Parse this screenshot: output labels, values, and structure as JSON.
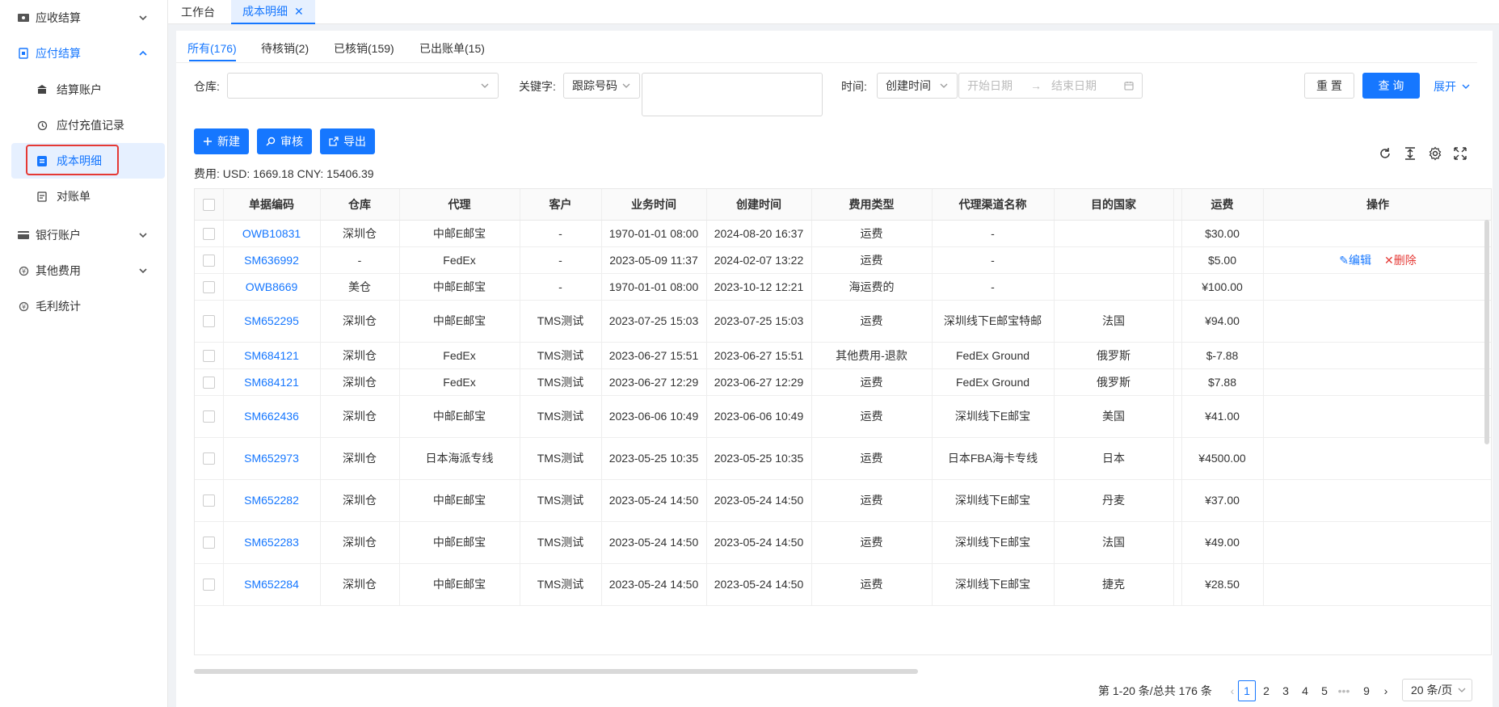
{
  "sidebar": {
    "items": [
      {
        "label": "应收结算",
        "icon": "ticket-icon",
        "level": "top",
        "chevron": "down"
      },
      {
        "label": "应付结算",
        "icon": "file-icon",
        "level": "top",
        "chevron": "up",
        "open": true
      },
      {
        "label": "结算账户",
        "icon": "bank-icon",
        "level": "sub"
      },
      {
        "label": "应付充值记录",
        "icon": "recharge-icon",
        "level": "sub"
      },
      {
        "label": "成本明细",
        "icon": "cost-icon",
        "level": "sub",
        "active": true
      },
      {
        "label": "对账单",
        "icon": "statement-icon",
        "level": "sub"
      },
      {
        "label": "银行账户",
        "icon": "card-icon",
        "level": "top",
        "chevron": "down"
      },
      {
        "label": "其他费用",
        "icon": "coin-icon",
        "level": "top",
        "chevron": "down"
      },
      {
        "label": "毛利统计",
        "icon": "stats-icon",
        "level": "top"
      }
    ]
  },
  "top_tabs": [
    {
      "label": "工作台"
    },
    {
      "label": "成本明细",
      "current": true
    }
  ],
  "sub_tabs": [
    {
      "label": "所有(176)",
      "current": true
    },
    {
      "label": "待核销(2)"
    },
    {
      "label": "已核销(159)"
    },
    {
      "label": "已出账单(15)"
    }
  ],
  "filters": {
    "warehouse_label": "仓库:",
    "keyword_label": "关键字:",
    "keyword_type": "跟踪号码",
    "time_label": "时间:",
    "time_type": "创建时间",
    "start_date_placeholder": "开始日期",
    "end_date_placeholder": "结束日期",
    "date_separator": "→"
  },
  "buttons": {
    "reset": "重 置",
    "query": "查 询",
    "expand": "展开",
    "new": "新建",
    "audit": "审核",
    "export": "导出"
  },
  "fee_summary": "费用: USD: 1669.18 CNY: 15406.39",
  "table": {
    "columns": [
      "单据编码",
      "仓库",
      "代理",
      "客户",
      "业务时间",
      "创建时间",
      "费用类型",
      "代理渠道名称",
      "目的国家",
      "",
      "运费",
      "操作"
    ],
    "rows": [
      {
        "code": "OWB10831",
        "warehouse": "深圳仓",
        "agent": "中邮E邮宝",
        "customer": "-",
        "biz_time": "1970-01-01 08:00",
        "create_time": "2024-08-20 16:37",
        "fee_type": "运费",
        "channel": "-",
        "country": "",
        "freight": "$30.00",
        "edit": "",
        "del": ""
      },
      {
        "code": "SM636992",
        "warehouse": "-",
        "agent": "FedEx",
        "customer": "-",
        "biz_time": "2023-05-09 11:37",
        "create_time": "2024-02-07 13:22",
        "fee_type": "运费",
        "channel": "-",
        "country": "",
        "freight": "$5.00",
        "edit": "编辑",
        "del": "删除"
      },
      {
        "code": "OWB8669",
        "warehouse": "美仓",
        "agent": "中邮E邮宝",
        "customer": "-",
        "biz_time": "1970-01-01 08:00",
        "create_time": "2023-10-12 12:21",
        "fee_type": "海运费的",
        "channel": "-",
        "country": "",
        "freight": "¥100.00",
        "edit": "",
        "del": ""
      },
      {
        "code": "SM652295",
        "warehouse": "深圳仓",
        "agent": "中邮E邮宝",
        "customer": "TMS测试",
        "biz_time": "2023-07-25 15:03",
        "create_time": "2023-07-25 15:03",
        "fee_type": "运费",
        "channel": "深圳线下E邮宝特邮",
        "country": "法国",
        "freight": "¥94.00",
        "edit": "",
        "del": ""
      },
      {
        "code": "SM684121",
        "warehouse": "深圳仓",
        "agent": "FedEx",
        "customer": "TMS测试",
        "biz_time": "2023-06-27 15:51",
        "create_time": "2023-06-27 15:51",
        "fee_type": "其他费用-退款",
        "channel": "FedEx Ground",
        "country": "俄罗斯",
        "freight": "$-7.88",
        "edit": "",
        "del": ""
      },
      {
        "code": "SM684121",
        "warehouse": "深圳仓",
        "agent": "FedEx",
        "customer": "TMS测试",
        "biz_time": "2023-06-27 12:29",
        "create_time": "2023-06-27 12:29",
        "fee_type": "运费",
        "channel": "FedEx Ground",
        "country": "俄罗斯",
        "freight": "$7.88",
        "edit": "",
        "del": ""
      },
      {
        "code": "SM662436",
        "warehouse": "深圳仓",
        "agent": "中邮E邮宝",
        "customer": "TMS测试",
        "biz_time": "2023-06-06 10:49",
        "create_time": "2023-06-06 10:49",
        "fee_type": "运费",
        "channel": "深圳线下E邮宝",
        "country": "美国",
        "freight": "¥41.00",
        "edit": "",
        "del": ""
      },
      {
        "code": "SM652973",
        "warehouse": "深圳仓",
        "agent": "日本海派专线",
        "customer": "TMS测试",
        "biz_time": "2023-05-25 10:35",
        "create_time": "2023-05-25 10:35",
        "fee_type": "运费",
        "channel": "日本FBA海卡专线",
        "country": "日本",
        "freight": "¥4500.00",
        "edit": "",
        "del": ""
      },
      {
        "code": "SM652282",
        "warehouse": "深圳仓",
        "agent": "中邮E邮宝",
        "customer": "TMS测试",
        "biz_time": "2023-05-24 14:50",
        "create_time": "2023-05-24 14:50",
        "fee_type": "运费",
        "channel": "深圳线下E邮宝",
        "country": "丹麦",
        "freight": "¥37.00",
        "edit": "",
        "del": ""
      },
      {
        "code": "SM652283",
        "warehouse": "深圳仓",
        "agent": "中邮E邮宝",
        "customer": "TMS测试",
        "biz_time": "2023-05-24 14:50",
        "create_time": "2023-05-24 14:50",
        "fee_type": "运费",
        "channel": "深圳线下E邮宝",
        "country": "法国",
        "freight": "¥49.00",
        "edit": "",
        "del": ""
      },
      {
        "code": "SM652284",
        "warehouse": "深圳仓",
        "agent": "中邮E邮宝",
        "customer": "TMS测试",
        "biz_time": "2023-05-24 14:50",
        "create_time": "2023-05-24 14:50",
        "fee_type": "运费",
        "channel": "深圳线下E邮宝",
        "country": "捷克",
        "freight": "¥28.50",
        "edit": "",
        "del": ""
      }
    ]
  },
  "pagination": {
    "summary": "第 1-20 条/总共 176 条",
    "pages": [
      "1",
      "2",
      "3",
      "4",
      "5",
      "•••",
      "9"
    ],
    "current": "1",
    "page_size": "20 条/页"
  },
  "colors": {
    "primary": "#1677ff",
    "danger": "#e53935",
    "highlight": "#e53935"
  }
}
